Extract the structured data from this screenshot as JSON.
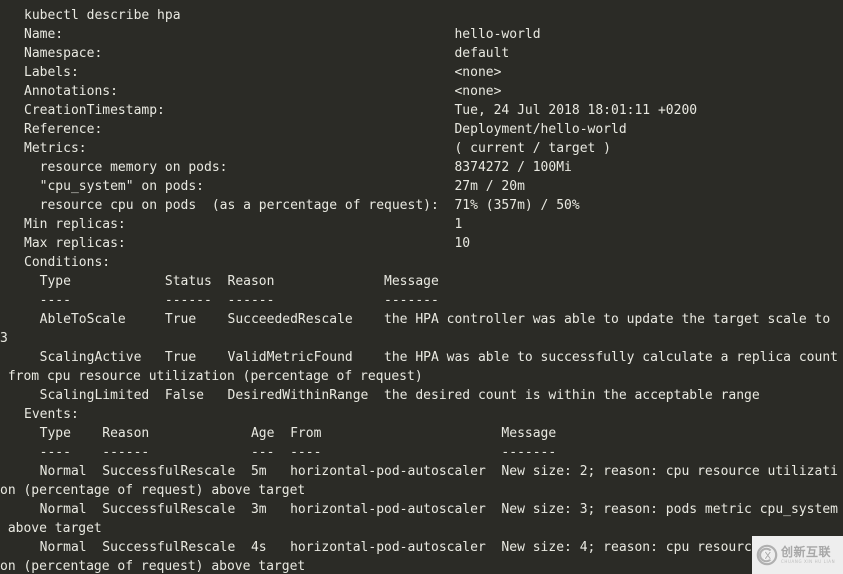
{
  "terminal": {
    "background_color": "#2b2b26",
    "foreground_color": "#e9e9e1",
    "command": "kubectl describe hpa",
    "lines": [
      "kubectl describe hpa",
      "Name:                                                  hello-world",
      "Namespace:                                             default",
      "Labels:                                                <none>",
      "Annotations:                                           <none>",
      "CreationTimestamp:                                     Tue, 24 Jul 2018 18:01:11 +0200",
      "Reference:                                             Deployment/hello-world",
      "Metrics:                                               ( current / target )",
      "  resource memory on pods:                             8374272 / 100Mi",
      "  \"cpu_system\" on pods:                                27m / 20m",
      "  resource cpu on pods  (as a percentage of request):  71% (357m) / 50%",
      "Min replicas:                                          1",
      "Max replicas:                                          10",
      "Conditions:",
      "  Type            Status  Reason              Message",
      "  ----            ------  ------              -------",
      "  AbleToScale     True    SucceededRescale    the HPA controller was able to update the target scale to 3",
      "  ScalingActive   True    ValidMetricFound    the HPA was able to successfully calculate a replica count from cpu resource utilization (percentage of request)",
      "  ScalingLimited  False   DesiredWithinRange  the desired count is within the acceptable range",
      "Events:",
      "  Type    Reason             Age  From                       Message",
      "  ----    ------             ---  ----                       -------",
      "  Normal  SuccessfulRescale  5m   horizontal-pod-autoscaler  New size: 2; reason: cpu resource utilization (percentage of request) above target",
      "  Normal  SuccessfulRescale  3m   horizontal-pod-autoscaler  New size: 3; reason: pods metric cpu_system above target",
      "  Normal  SuccessfulRescale  4s   horizontal-pod-autoscaler  New size: 4; reason: cpu resource utilization (percentage of request) above target"
    ],
    "fields": {
      "name_label": "Name:",
      "name_value": "hello-world",
      "namespace_label": "Namespace:",
      "namespace_value": "default",
      "labels_label": "Labels:",
      "labels_value": "<none>",
      "annotations_label": "Annotations:",
      "annotations_value": "<none>",
      "creation_timestamp_label": "CreationTimestamp:",
      "creation_timestamp_value": "Tue, 24 Jul 2018 18:01:11 +0200",
      "reference_label": "Reference:",
      "reference_value": "Deployment/hello-world",
      "metrics_label": "Metrics:",
      "metrics_header_value": "( current / target )",
      "metric_memory_label": "  resource memory on pods:",
      "metric_memory_value": "8374272 / 100Mi",
      "metric_cpu_system_label": "  \"cpu_system\" on pods:",
      "metric_cpu_system_value": "27m / 20m",
      "metric_cpu_label": "  resource cpu on pods  (as a percentage of request):",
      "metric_cpu_value": "71% (357m) / 50%",
      "min_replicas_label": "Min replicas:",
      "min_replicas_value": "1",
      "max_replicas_label": "Max replicas:",
      "max_replicas_value": "10",
      "conditions_label": "Conditions:",
      "events_label": "Events:"
    },
    "conditions": {
      "headers": [
        "Type",
        "Status",
        "Reason",
        "Message"
      ],
      "rules": [
        "----",
        "------",
        "------",
        "-------"
      ],
      "rows": [
        {
          "type": "AbleToScale",
          "status": "True",
          "reason": "SucceededRescale",
          "message": "the HPA controller was able to update the target scale to 3"
        },
        {
          "type": "ScalingActive",
          "status": "True",
          "reason": "ValidMetricFound",
          "message": "the HPA was able to successfully calculate a replica count from cpu resource utilization (percentage of request)"
        },
        {
          "type": "ScalingLimited",
          "status": "False",
          "reason": "DesiredWithinRange",
          "message": "the desired count is within the acceptable range"
        }
      ]
    },
    "events": {
      "headers": [
        "Type",
        "Reason",
        "Age",
        "From",
        "Message"
      ],
      "rules": [
        "----",
        "------",
        "---",
        "----",
        "-------"
      ],
      "rows": [
        {
          "type": "Normal",
          "reason": "SuccessfulRescale",
          "age": "5m",
          "from": "horizontal-pod-autoscaler",
          "message": "New size: 2; reason: cpu resource utilization (percentage of request) above target"
        },
        {
          "type": "Normal",
          "reason": "SuccessfulRescale",
          "age": "3m",
          "from": "horizontal-pod-autoscaler",
          "message": "New size: 3; reason: pods metric cpu_system above target"
        },
        {
          "type": "Normal",
          "reason": "SuccessfulRescale",
          "age": "4s",
          "from": "horizontal-pod-autoscaler",
          "message": "New size: 4; reason: cpu resource utilization (percentage of request) above target"
        }
      ]
    }
  },
  "watermark": {
    "cn_text": "创新互联",
    "en_text": "CHUANG XIN HU LIAN",
    "background_color": "#eeeeee",
    "mark_color": "#b0b0b0"
  }
}
